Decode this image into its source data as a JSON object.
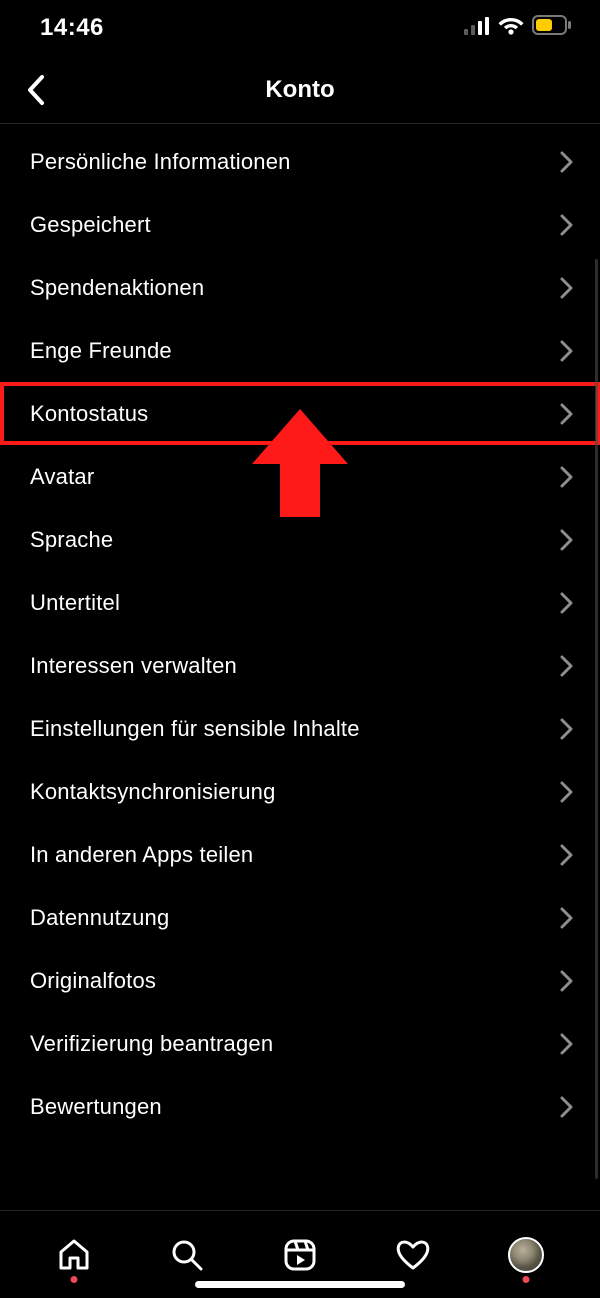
{
  "status": {
    "time": "14:46"
  },
  "header": {
    "title": "Konto"
  },
  "menu": {
    "items": [
      {
        "label": "Persönliche Informationen",
        "highlight": false
      },
      {
        "label": "Gespeichert",
        "highlight": false
      },
      {
        "label": "Spendenaktionen",
        "highlight": false
      },
      {
        "label": "Enge Freunde",
        "highlight": false
      },
      {
        "label": "Kontostatus",
        "highlight": true
      },
      {
        "label": "Avatar",
        "highlight": false
      },
      {
        "label": "Sprache",
        "highlight": false
      },
      {
        "label": "Untertitel",
        "highlight": false
      },
      {
        "label": "Interessen verwalten",
        "highlight": false
      },
      {
        "label": "Einstellungen für sensible Inhalte",
        "highlight": false
      },
      {
        "label": "Kontaktsynchronisierung",
        "highlight": false
      },
      {
        "label": "In anderen Apps teilen",
        "highlight": false
      },
      {
        "label": "Datennutzung",
        "highlight": false
      },
      {
        "label": "Originalfotos",
        "highlight": false
      },
      {
        "label": "Verifizierung beantragen",
        "highlight": false
      },
      {
        "label": "Bewertungen",
        "highlight": false
      }
    ]
  },
  "annotation": {
    "highlight_color": "#ff1a1a"
  }
}
